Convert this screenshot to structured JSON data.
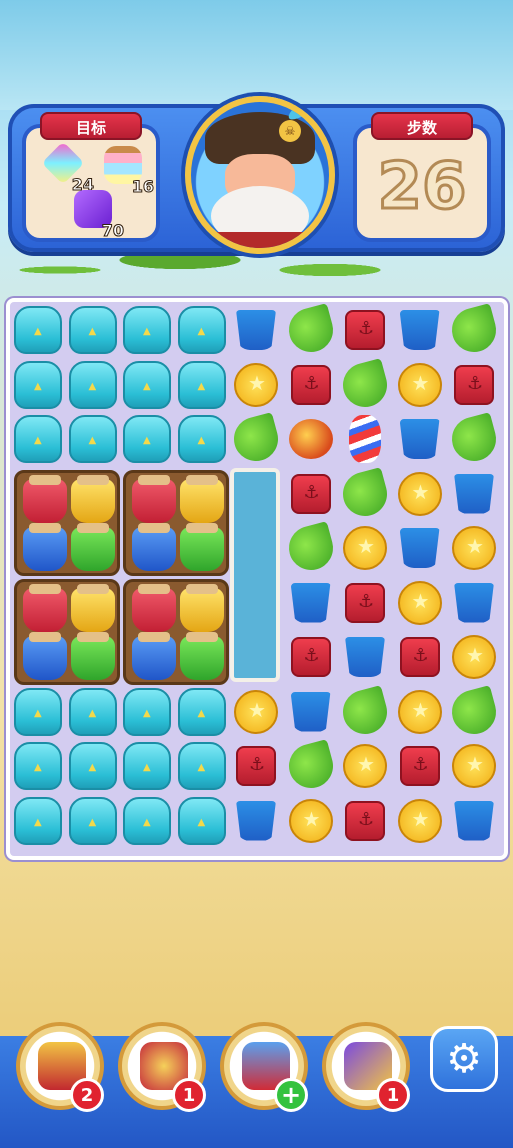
{
  "goals": {
    "title": "目标",
    "items": [
      {
        "icon": "rainbow-gem-icon",
        "count": "24"
      },
      {
        "icon": "jar-icon",
        "count": "16"
      },
      {
        "icon": "purple-cube-icon",
        "count": "70"
      }
    ]
  },
  "moves": {
    "title": "步数",
    "value": "26"
  },
  "character": {
    "icon": "pirate-captain-portrait"
  },
  "board": {
    "rows": [
      [
        "ice",
        "ice",
        "ice",
        "ice",
        "cup",
        "leaf",
        "box",
        "cup",
        "leaf"
      ],
      [
        "ice",
        "ice",
        "ice",
        "ice",
        "coin",
        "box",
        "leaf",
        "coin",
        "box"
      ],
      [
        "ice",
        "ice",
        "ice",
        "ice",
        "leaf",
        "bomb",
        "rocket",
        "cup",
        "leaf"
      ],
      [
        "jar",
        "jar",
        "jar",
        "jar",
        "slot",
        "box",
        "leaf",
        "coin",
        "cup"
      ],
      [
        "jar",
        "jar",
        "jar",
        "jar",
        "slot",
        "leaf",
        "coin",
        "cup",
        "coin"
      ],
      [
        "jar",
        "jar",
        "jar",
        "jar",
        "slot",
        "cup",
        "box",
        "coin",
        "cup"
      ],
      [
        "jar",
        "jar",
        "jar",
        "jar",
        "slot",
        "box",
        "cup",
        "box",
        "coin"
      ],
      [
        "ice",
        "ice",
        "ice",
        "ice",
        "coin",
        "cup",
        "leaf",
        "coin",
        "leaf"
      ],
      [
        "ice",
        "ice",
        "ice",
        "ice",
        "box",
        "leaf",
        "coin",
        "box",
        "coin"
      ],
      [
        "ice",
        "ice",
        "ice",
        "ice",
        "cup",
        "coin",
        "box",
        "coin",
        "cup"
      ]
    ]
  },
  "boosters": [
    {
      "icon": "hammer-booster-icon",
      "count": "2"
    },
    {
      "icon": "horn-booster-icon",
      "count": "1"
    },
    {
      "icon": "cannon-booster-icon",
      "count": "+"
    },
    {
      "icon": "wizard-hat-booster-icon",
      "count": "1"
    }
  ],
  "settings": {
    "icon": "gear-icon",
    "glyph": "⚙"
  },
  "colors": {
    "header": "#2c63d6",
    "ribbon": "#e5344a",
    "board": "#d3ccf0"
  }
}
